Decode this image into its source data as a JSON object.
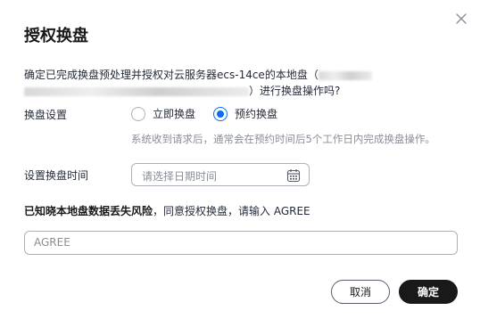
{
  "dialog": {
    "title": "授权换盘",
    "description_before": "确定已完成换盘预处理并授权对云服务器ecs-14ce的本地盘（",
    "description_after": "）进行换盘操作吗?",
    "swap_setting_label": "换盘设置",
    "options": [
      {
        "label": "立即换盘",
        "selected": false
      },
      {
        "label": "预约换盘",
        "selected": true
      }
    ],
    "hint": "系统收到请求后，通常会在预约时间后5个工作日内完成换盘操作。",
    "time_label": "设置换盘时间",
    "time_placeholder": "请选择日期时间",
    "warning_bold": "已知晓本地盘数据丢失风险",
    "warning_rest": "，同意授权换盘，请输入 AGREE",
    "confirm_input_placeholder": "AGREE",
    "cancel_label": "取消",
    "confirm_label": "确定"
  },
  "colors": {
    "accent": "#0a6cf2",
    "primary_button": "#191919",
    "hint_text": "#8a8e99"
  },
  "icons": {
    "close": "close-icon",
    "calendar": "calendar-icon"
  }
}
